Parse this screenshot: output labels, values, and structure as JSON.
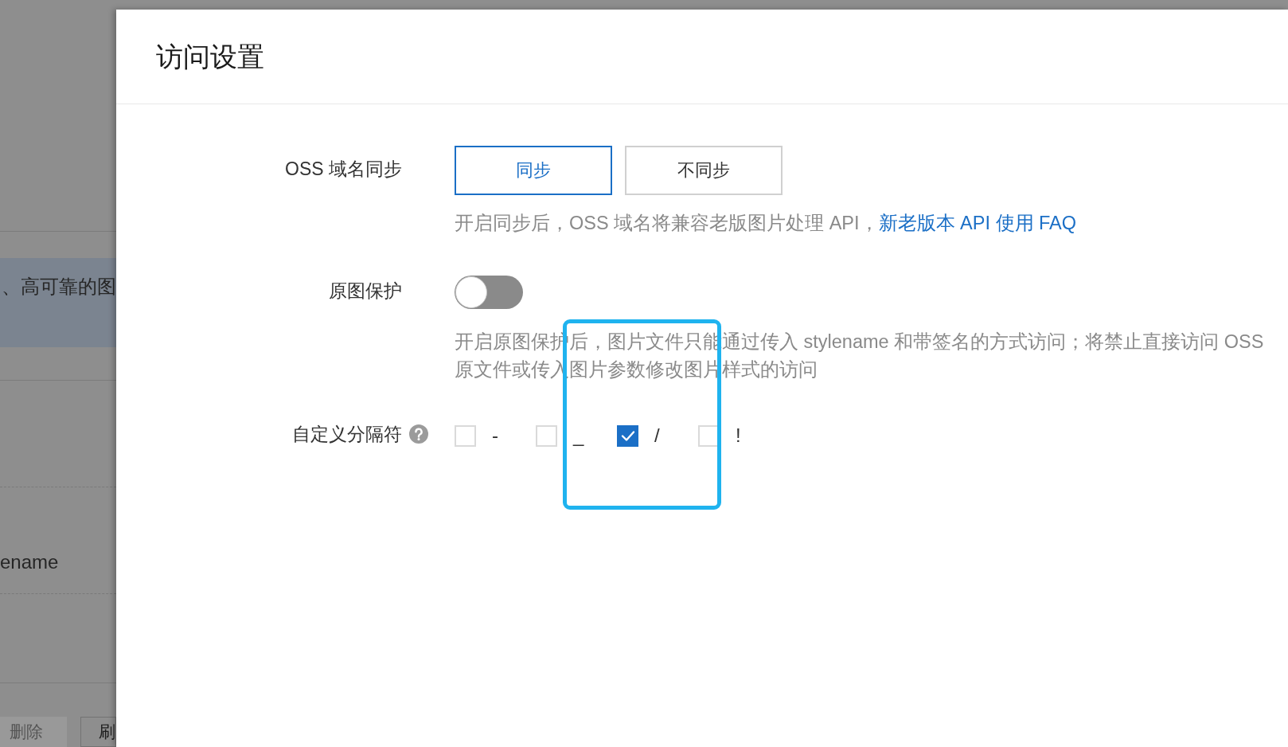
{
  "background_page": {
    "highlighted_row_text": "、高可靠的图",
    "row_text": "ename",
    "buttons": [
      {
        "label": "删除",
        "disabled": true
      },
      {
        "label": "刷",
        "disabled": false
      }
    ]
  },
  "drawer": {
    "title": "访问设置",
    "fields": [
      {
        "kind": "segmented",
        "label": "OSS 域名同步",
        "options": [
          {
            "label": "同步",
            "selected": true
          },
          {
            "label": "不同步",
            "selected": false
          }
        ],
        "description": "开启同步后，OSS 域名将兼容老版图片处理 API，",
        "link": "新老版本 API 使用 FAQ"
      },
      {
        "kind": "switch",
        "label": "原图保护",
        "on": false,
        "description": "开启原图保护后，图片文件只能通过传入 stylename 和带签名的方式访问；将禁止直接访问 OSS 原文件或传入图片参数修改图片样式的访问"
      },
      {
        "kind": "checkboxes",
        "label": "自定义分隔符",
        "help": true,
        "options": [
          {
            "label": "-",
            "checked": false
          },
          {
            "label": "_",
            "checked": false
          },
          {
            "label": "/",
            "checked": true
          },
          {
            "label": "!",
            "checked": false
          }
        ]
      }
    ]
  },
  "annotations": [
    {
      "kind": "rectangle"
    }
  ]
}
